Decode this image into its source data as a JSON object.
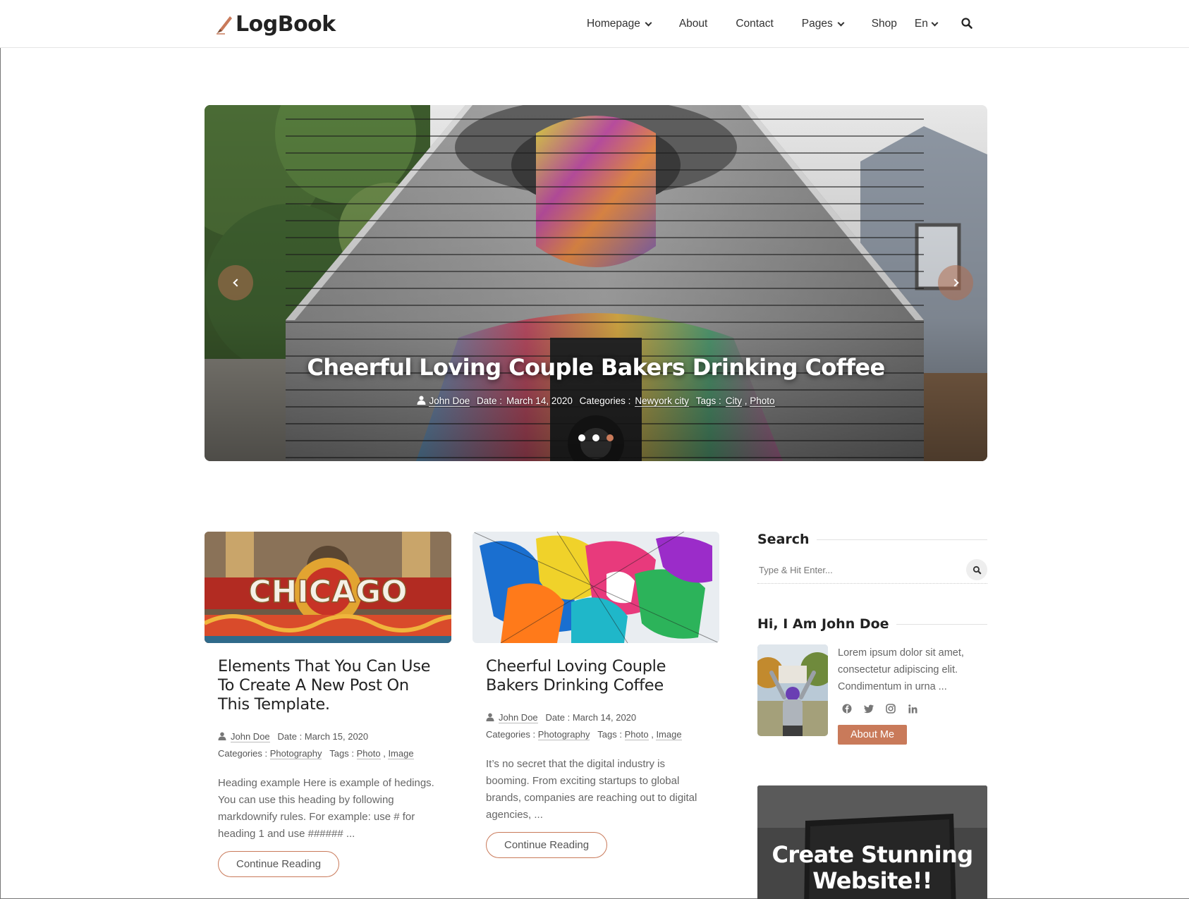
{
  "brand": {
    "name": "LogBook",
    "accent": "#c97a5a"
  },
  "nav": {
    "items": [
      {
        "label": "Homepage",
        "dropdown": true
      },
      {
        "label": "About",
        "dropdown": false
      },
      {
        "label": "Contact",
        "dropdown": false
      },
      {
        "label": "Pages",
        "dropdown": true
      },
      {
        "label": "Shop",
        "dropdown": false
      },
      {
        "label": "En",
        "dropdown": true
      }
    ],
    "search_icon": "search-icon"
  },
  "hero": {
    "title": "Cheerful Loving Couple Bakers Drinking Coffee",
    "author": "John Doe",
    "date_label": "Date :",
    "date": "March 14, 2020",
    "categories_label": "Categories :",
    "category": "Newyork city",
    "tags_label": "Tags :",
    "tags": [
      "City",
      "Photo"
    ],
    "slide_count": 3,
    "active_slide": 3
  },
  "posts": [
    {
      "title": "Elements That You Can Use To Create A New Post On This Template.",
      "author": "John Doe",
      "date_label": "Date :",
      "date": "March 15, 2020",
      "categories_label": "Categories :",
      "category": "Photography",
      "tags_label": "Tags :",
      "tags": [
        "Photo",
        "Image"
      ],
      "excerpt": "Heading example Here is example of hedings. You can use this heading by following markdownify rules. For example: use # for heading 1 and use ###### ...",
      "button": "Continue Reading"
    },
    {
      "title": "Cheerful Loving Couple Bakers Drinking Coffee",
      "author": "John Doe",
      "date_label": "Date :",
      "date": "March 14, 2020",
      "categories_label": "Categories :",
      "category": "Photography",
      "tags_label": "Tags :",
      "tags": [
        "Photo",
        "Image"
      ],
      "excerpt": "It’s no secret that the digital industry is booming. From exciting startups to global brands, companies are reaching out to digital agencies, ...",
      "button": "Continue Reading"
    }
  ],
  "sidebar": {
    "search": {
      "title": "Search",
      "placeholder": "Type & Hit Enter..."
    },
    "about": {
      "title": "Hi, I Am John Doe",
      "text": "Lorem ipsum dolor sit amet, consectetur adipiscing elit. Condimentum in urna ...",
      "socials": [
        "facebook-icon",
        "twitter-icon",
        "instagram-icon",
        "linkedin-icon"
      ],
      "button": "About Me"
    },
    "promo": {
      "text": "Create Stunning Website!!"
    }
  }
}
